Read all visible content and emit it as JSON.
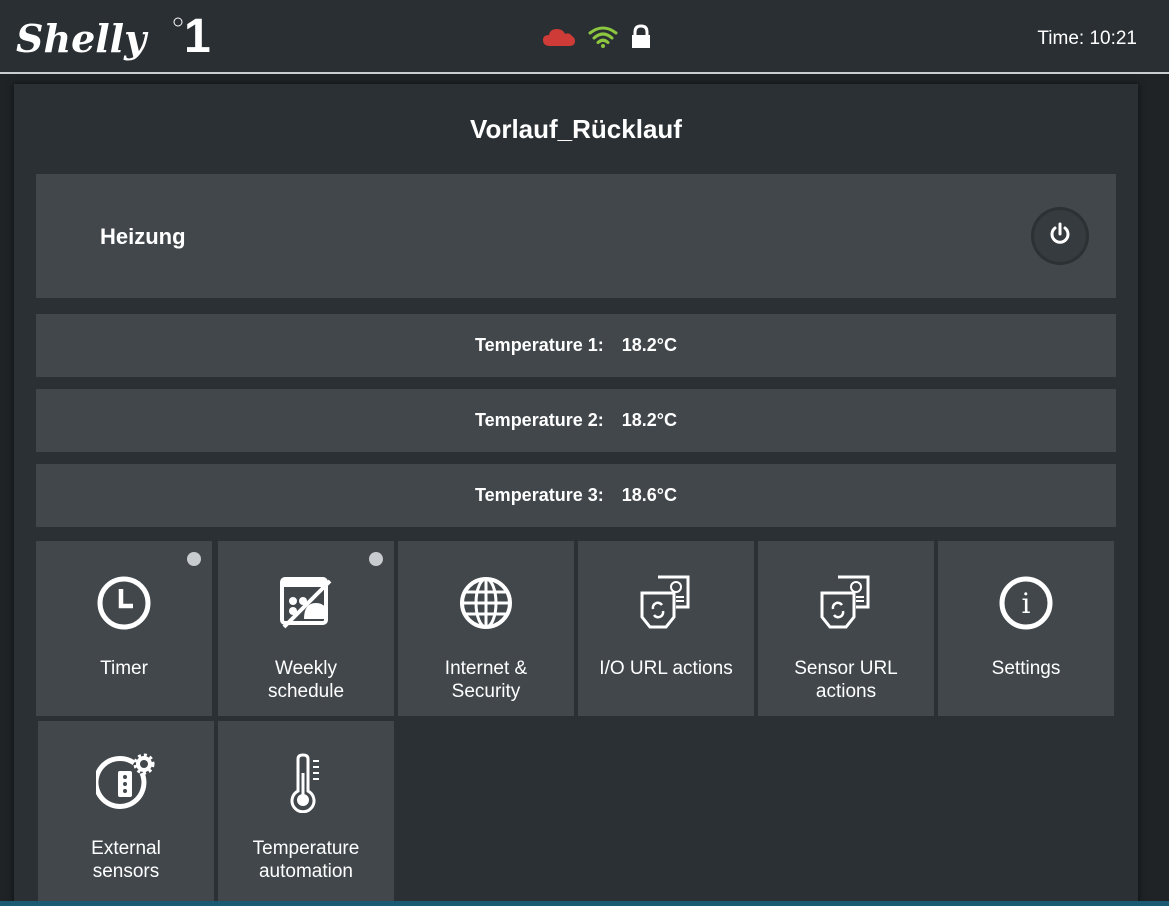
{
  "header": {
    "logo_text": "Shelly 1",
    "time_label": "Time:",
    "time_value": "10:21",
    "status_icons": [
      "cloud-icon",
      "wifi-icon",
      "lock-icon"
    ],
    "cloud_color": "#cf3b36",
    "wifi_color": "#8dc63f"
  },
  "device": {
    "title": "Vorlauf_Rücklauf"
  },
  "relay": {
    "name": "Heizung",
    "icon": "power-icon"
  },
  "temperatures": [
    {
      "label": "Temperature 1:",
      "value": "18.2°C"
    },
    {
      "label": "Temperature 2:",
      "value": "18.2°C"
    },
    {
      "label": "Temperature 3:",
      "value": "18.6°C"
    }
  ],
  "menu": [
    {
      "id": "timer",
      "lines": [
        "Timer"
      ],
      "icon": "clock-icon",
      "indicator": true
    },
    {
      "id": "weekly-schedule",
      "lines": [
        "Weekly",
        "schedule"
      ],
      "icon": "schedule-icon",
      "indicator": true
    },
    {
      "id": "internet-security",
      "lines": [
        "Internet &",
        "Security"
      ],
      "icon": "globe-icon",
      "indicator": false
    },
    {
      "id": "io-url-actions",
      "lines": [
        "I/O URL actions"
      ],
      "icon": "url-actions-icon",
      "indicator": false
    },
    {
      "id": "sensor-url-actions",
      "lines": [
        "Sensor URL",
        "actions"
      ],
      "icon": "url-actions-icon",
      "indicator": false
    },
    {
      "id": "settings",
      "lines": [
        "Settings"
      ],
      "icon": "info-icon",
      "indicator": false
    },
    {
      "id": "external-sensors",
      "lines": [
        "External",
        "sensors"
      ],
      "icon": "sensor-gear-icon",
      "indicator": false
    },
    {
      "id": "temperature-automation",
      "lines": [
        "Temperature",
        "automation"
      ],
      "icon": "thermometer-icon",
      "indicator": false
    }
  ]
}
